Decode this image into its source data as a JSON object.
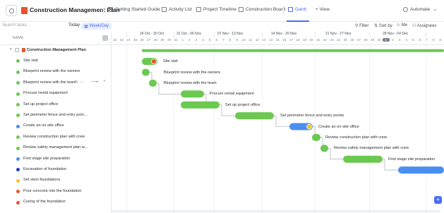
{
  "header": {
    "project_title": "Construction Management Plan",
    "tabs": [
      {
        "label": "Getting Started Guide"
      },
      {
        "label": "Activity List"
      },
      {
        "label": "Project Timeline"
      },
      {
        "label": "Construction Board"
      },
      {
        "label": "Gantt",
        "active": true
      },
      {
        "label": "+ View"
      }
    ],
    "automate": "Automate"
  },
  "toolbar": {
    "search_placeholder": "Search tasks...",
    "today": "Today",
    "scale": "Week/Day",
    "filter": "Filter",
    "sort": "Sort by",
    "me": "Me",
    "assignees": "Assignees"
  },
  "list": {
    "column_header": "NAME",
    "parent": "Construction Management Plan",
    "tasks": [
      {
        "name": "Site visit",
        "color": "#6bc950"
      },
      {
        "name": "Blueprint review with the owners",
        "color": "#6bc950"
      },
      {
        "name": "Blueprint review with the team",
        "color": "#6bc950"
      },
      {
        "name": "Procure rental equipment",
        "color": "#6bc950"
      },
      {
        "name": "Set up project office",
        "color": "#6bc950"
      },
      {
        "name": "Set perimeter fence and entry poin...",
        "color": "#6bc950"
      },
      {
        "name": "Create an on-site office",
        "color": "#4a8ef0"
      },
      {
        "name": "Review construction plan with crew",
        "color": "#6bc950"
      },
      {
        "name": "Review safety management plan w...",
        "color": "#6bc950"
      },
      {
        "name": "First stage site preparation",
        "color": "#4a8ef0"
      },
      {
        "name": "Excavation of foundation",
        "color": "#1a3fc2"
      },
      {
        "name": "Set steel foundations",
        "color": "#f5c518"
      },
      {
        "name": "Pour concrete into the foundation",
        "color": "#e8532b"
      },
      {
        "name": "Curing of the foundation",
        "color": "#e8532b"
      }
    ]
  },
  "timeline": {
    "ranges": [
      "24 Oct - 30 Oct",
      "31 Oct - 06 Nov",
      "07 Nov - 13 Nov",
      "14 Nov - 20 Nov",
      "21 Nov - 27 Nov",
      "28 Nov - 04 Dec"
    ],
    "days": [
      "22",
      "23",
      "24",
      "25",
      "26",
      "27",
      "28",
      "29",
      "30",
      "31",
      "1",
      "2",
      "3",
      "4",
      "5",
      "6",
      "7",
      "8",
      "9",
      "10",
      "11",
      "12",
      "13",
      "14",
      "15",
      "16",
      "17",
      "18",
      "19",
      "20",
      "21",
      "22",
      "23",
      "24",
      "25",
      "26",
      "27",
      "28",
      "29",
      "30",
      "1",
      "2",
      "3",
      "4",
      "5",
      "6",
      "7",
      "8",
      "9"
    ],
    "highlight_day_index": 40,
    "bar_labels": [
      "Site visit",
      "Blueprint review with the owners",
      "Blueprint review with the team",
      "Procure rental equipment",
      "Set up project office",
      "Set perimeter fence and entry points",
      "Create an on-site office",
      "Review construction plan with crew",
      "Review safety management plan with crew",
      "First stage site preparation"
    ]
  },
  "colors": {
    "green_bar": "#6bc950",
    "blue_bar": "#4a8ef0",
    "accent": "#4a6cf7"
  }
}
